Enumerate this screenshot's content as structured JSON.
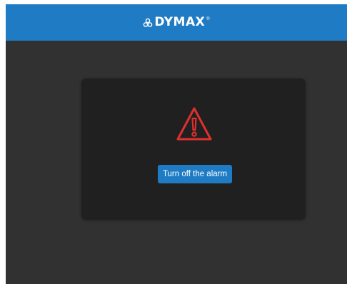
{
  "header": {
    "brand_name": "DYMAX",
    "brand_mark": "dymax-logo-mark",
    "registered_symbol": "®",
    "background_color": "#1f7cc4"
  },
  "dialog": {
    "icon": "warning-triangle-icon",
    "icon_color": "#e0302e",
    "button_label": "Turn off the alarm",
    "button_color": "#1f7cc4"
  },
  "colors": {
    "page_background": "#313131",
    "dialog_background": "#202020"
  }
}
